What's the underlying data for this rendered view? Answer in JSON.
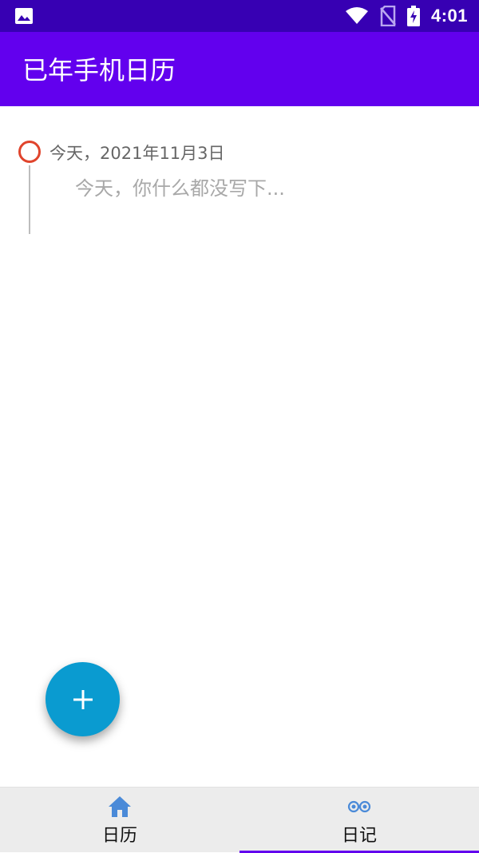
{
  "status_bar": {
    "time": "4:01",
    "icons": [
      "image-icon",
      "wifi-icon",
      "no-sim-icon",
      "battery-charging-icon"
    ]
  },
  "app_bar": {
    "title": "已年手机日历"
  },
  "timeline": {
    "entries": [
      {
        "date": "今天，2021年11月3日",
        "text": "今天，你什么都没写下..."
      }
    ]
  },
  "fab": {
    "icon": "plus-icon",
    "color": "#0a9bd0"
  },
  "bottom_nav": {
    "items": [
      {
        "label": "日历",
        "icon": "home-icon",
        "selected": false
      },
      {
        "label": "日记",
        "icon": "diary-icon",
        "selected": true
      }
    ]
  },
  "colors": {
    "status_bar": "#3700b3",
    "app_bar": "#6200ee",
    "timeline_marker": "#e0442c",
    "nav_icon": "#4a8ad8"
  }
}
